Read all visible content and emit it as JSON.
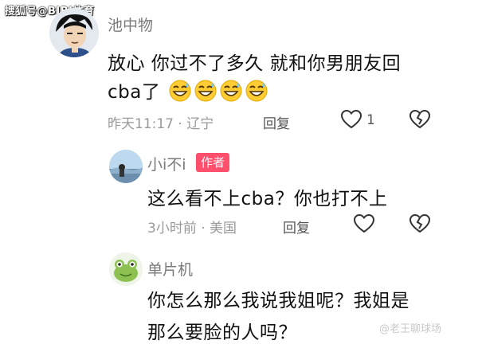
{
  "watermark_top": "搜狐号@BIBI体育",
  "watermark_bottom": "@老王聊球场",
  "comments": [
    {
      "username": "池中物",
      "text_line1": "放心 你过不了多久 就和你男朋友回",
      "text_line2": "cba了",
      "emoji": "grinning-sweat-emoji",
      "emoji_count": 4,
      "meta": "昨天11:17 · 辽宁",
      "reply_label": "回复",
      "like_count": "1"
    },
    {
      "username": "小i不i",
      "badge": "作者",
      "text_line1": "这么看不上cba？你也打不上",
      "meta": "3小时前 · 美国",
      "reply_label": "回复"
    },
    {
      "username": "单片机",
      "text_line1": "你怎么那么我说我姐呢？我姐是",
      "text_line2": "那么要脸的人吗？"
    }
  ],
  "colors": {
    "badge_bg": "#ff4f6d",
    "username": "#7a7a7a",
    "meta": "#999999"
  }
}
